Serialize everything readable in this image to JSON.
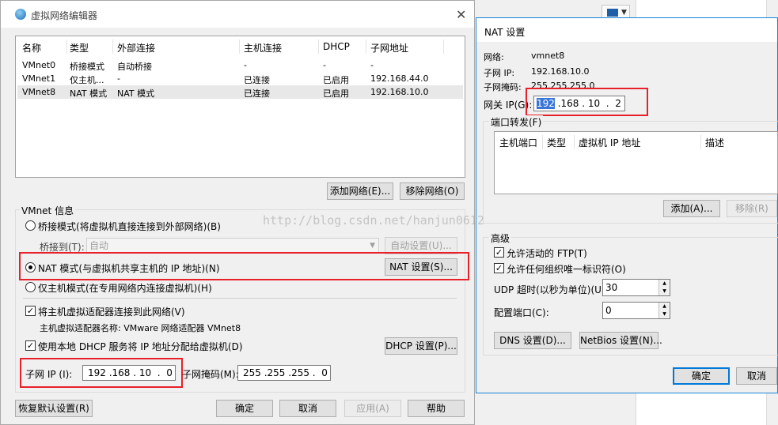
{
  "main_dialog": {
    "title": "虚拟网络编辑器",
    "close": "✕",
    "list": {
      "headers": [
        "名称",
        "类型",
        "外部连接",
        "主机连接",
        "DHCP",
        "子网地址"
      ],
      "rows": [
        [
          "VMnet0",
          "桥接模式",
          "自动桥接",
          "-",
          "-",
          "-"
        ],
        [
          "VMnet1",
          "仅主机...",
          "-",
          "已连接",
          "已启用",
          "192.168.44.0"
        ],
        [
          "VMnet8",
          "NAT 模式",
          "NAT 模式",
          "已连接",
          "已启用",
          "192.168.10.0"
        ]
      ]
    },
    "add_network": "添加网络(E)...",
    "remove_network": "移除网络(O)",
    "vmnet_info_label": "VMnet 信息",
    "bridge_mode": "桥接模式(将虚拟机直接连接到外部网络)(B)",
    "bridge_to_label": "桥接到(T):",
    "bridge_to_value": "自动",
    "auto_settings": "自动设置(U)...",
    "nat_mode": "NAT 模式(与虚拟机共享主机的 IP 地址)(N)",
    "nat_settings": "NAT 设置(S)...",
    "host_only_mode": "仅主机模式(在专用网络内连接虚拟机)(H)",
    "connect_adapter": "将主机虚拟适配器连接到此网络(V)",
    "adapter_name": "主机虚拟适配器名称: VMware 网络适配器 VMnet8",
    "use_dhcp": "使用本地 DHCP 服务将 IP 地址分配给虚拟机(D)",
    "dhcp_settings": "DHCP 设置(P)...",
    "subnet_ip_label": "子网 IP (I):",
    "subnet_ip_value": "192 .168 . 10  .  0",
    "subnet_mask_label": "子网掩码(M):",
    "subnet_mask_value": "255 .255 .255 .  0",
    "restore_defaults": "恢复默认设置(R)",
    "ok": "确定",
    "cancel": "取消",
    "apply": "应用(A)",
    "help": "帮助"
  },
  "nat_dialog": {
    "title": "NAT 设置",
    "network_label": "网络:",
    "network_value": "vmnet8",
    "subnet_ip_label": "子网 IP:",
    "subnet_ip_value": "192.168.10.0",
    "subnet_mask_label": "子网掩码:",
    "subnet_mask_value": "255.255.255.0",
    "gateway_label": "网关 IP(G):",
    "gateway_first": "192",
    "gateway_rest": " .168 . 10  .  2",
    "port_forward_label": "端口转发(F)",
    "pf_headers": [
      "主机端口",
      "类型",
      "虚拟机 IP 地址",
      "描述"
    ],
    "add": "添加(A)...",
    "remove": "移除(R)",
    "advanced_label": "高级",
    "allow_ftp": "允许活动的 FTP(T)",
    "allow_oui": "允许任何组织唯一标识符(O)",
    "udp_timeout_label": "UDP 超时(以秒为单位)(U):",
    "udp_timeout_value": "30",
    "config_port_label": "配置端口(C):",
    "config_port_value": "0",
    "dns_settings": "DNS 设置(D)...",
    "netbios_settings": "NetBios 设置(N)...",
    "ok": "确定",
    "cancel": "取消"
  },
  "watermark": "http://blog.csdn.net/hanjun0612",
  "colors": {
    "highlight_red": "#e8202a",
    "selection_blue": "#3875d7",
    "dialog_bg": "#f0f0f0"
  }
}
